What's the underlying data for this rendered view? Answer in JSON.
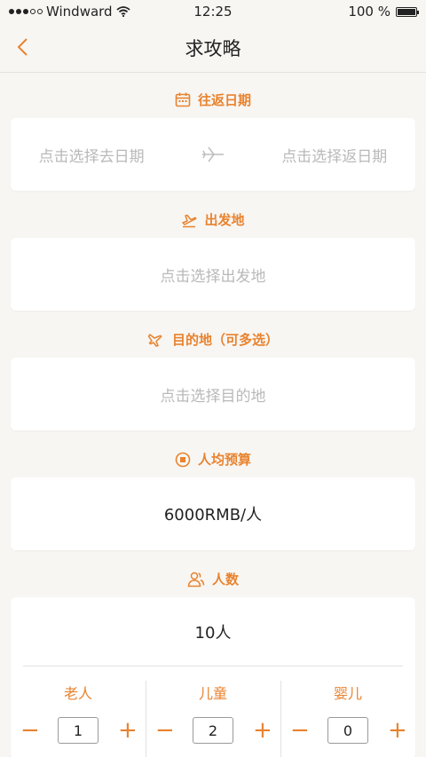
{
  "status": {
    "carrier": "Windward",
    "time": "12:25",
    "battery": "100 %"
  },
  "nav": {
    "title": "求攻略"
  },
  "dates": {
    "heading": "往返日期",
    "depart_placeholder": "点击选择去日期",
    "return_placeholder": "点击选择返日期"
  },
  "origin": {
    "heading": "出发地",
    "placeholder": "点击选择出发地"
  },
  "destination": {
    "heading": "目的地（可多选）",
    "placeholder": "点击选择目的地"
  },
  "budget": {
    "heading": "人均预算",
    "value": "6000RMB/人"
  },
  "people": {
    "heading": "人数",
    "total": "10人",
    "groups": [
      {
        "label": "老人",
        "count": "1"
      },
      {
        "label": "儿童",
        "count": "2"
      },
      {
        "label": "婴儿",
        "count": "0"
      }
    ],
    "minus": "−",
    "plus": "+"
  },
  "colors": {
    "accent": "#e8832f",
    "background": "#f8f6f3"
  }
}
